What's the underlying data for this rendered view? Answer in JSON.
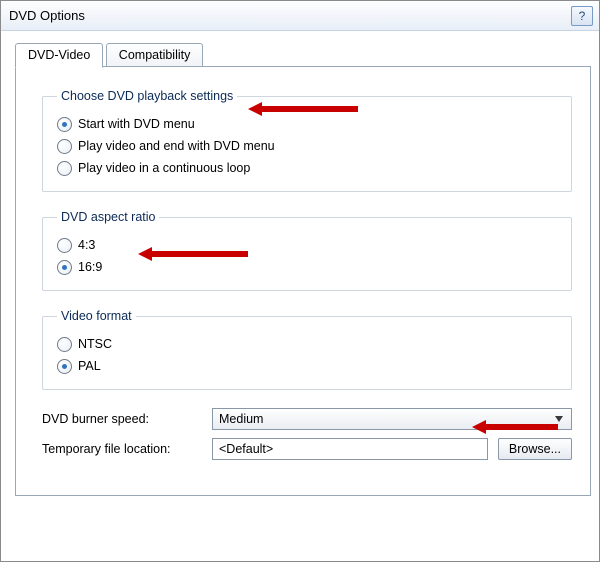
{
  "window": {
    "title": "DVD Options",
    "help_glyph": "?"
  },
  "tabs": [
    {
      "label": "DVD-Video",
      "active": true
    },
    {
      "label": "Compatibility",
      "active": false
    }
  ],
  "playback": {
    "legend": "Choose DVD playback settings",
    "options": [
      {
        "label": "Start with DVD menu",
        "checked": true
      },
      {
        "label": "Play video and end with DVD menu",
        "checked": false
      },
      {
        "label": "Play video in a continuous loop",
        "checked": false
      }
    ]
  },
  "aspect": {
    "legend": "DVD aspect ratio",
    "options": [
      {
        "label": "4:3",
        "checked": false
      },
      {
        "label": "16:9",
        "checked": true
      }
    ]
  },
  "format": {
    "legend": "Video format",
    "options": [
      {
        "label": "NTSC",
        "checked": false
      },
      {
        "label": "PAL",
        "checked": true
      }
    ]
  },
  "burner": {
    "label": "DVD burner speed:",
    "value": "Medium"
  },
  "temp": {
    "label": "Temporary file location:",
    "value": "<Default>",
    "browse": "Browse..."
  }
}
